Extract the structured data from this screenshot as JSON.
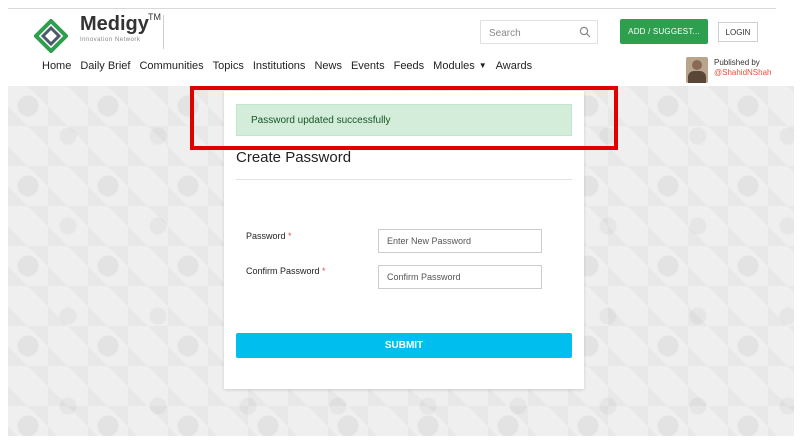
{
  "header": {
    "logo_text": "Medigy",
    "logo_tm": "TM",
    "logo_subtitle": "Innovation Network",
    "search_placeholder": "Search",
    "add_button": "ADD / SUGGEST...",
    "login_button": "LOGIN"
  },
  "nav": {
    "items": [
      "Home",
      "Daily Brief",
      "Communities",
      "Topics",
      "Institutions",
      "News",
      "Events",
      "Feeds",
      "Modules",
      "Awards"
    ]
  },
  "publisher": {
    "label": "Published by",
    "handle": "@ShahidNShah"
  },
  "form": {
    "alert": "Password updated successfully",
    "title": "Create Password",
    "password_label": "Password",
    "password_placeholder": "Enter New Password",
    "confirm_label": "Confirm Password",
    "confirm_placeholder": "Confirm Password",
    "required_mark": "*",
    "submit": "SUBMIT"
  },
  "colors": {
    "brand_green": "#2e9e4f",
    "submit_blue": "#00bfef",
    "alert_bg": "#d4edda",
    "highlight_red": "#e00000"
  }
}
